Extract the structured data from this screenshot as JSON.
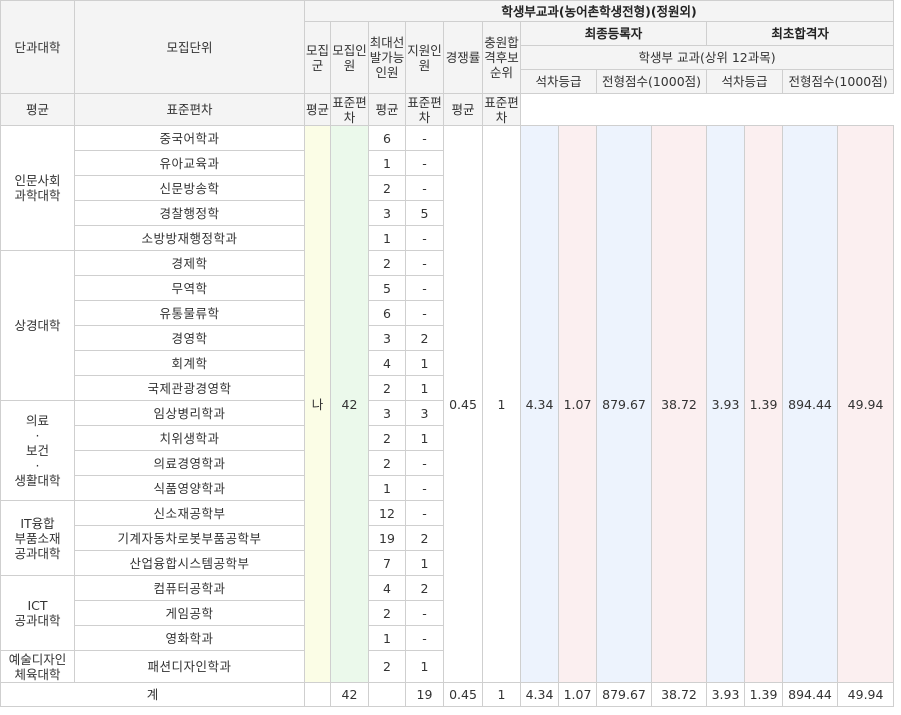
{
  "header": {
    "college": "단과대학",
    "unit": "모집단위",
    "group": "모집군",
    "recruit": "모집인원",
    "max_selectable": "최대선발가능인원",
    "applicants": "지원인원",
    "competition": "경쟁률",
    "waitlist": "충원합격후보순위",
    "main_title": "학생부교과(농어촌학생전형)(정원외)",
    "final_registered": "최종등록자",
    "first_passed": "최초합격자",
    "subject_basis": "학생부 교과(상위 12과목)",
    "grade": "석차등급",
    "score": "전형점수(1000점)",
    "avg": "평균",
    "std": "표준편차"
  },
  "merged": {
    "group": "나",
    "recruit": "42",
    "competition": "0.45",
    "waitlist": "1",
    "final": {
      "grade_avg": "4.34",
      "grade_std": "1.07",
      "score_avg": "879.67",
      "score_std": "38.72"
    },
    "first": {
      "grade_avg": "3.93",
      "grade_std": "1.39",
      "score_avg": "894.44",
      "score_std": "49.94"
    }
  },
  "colleges": [
    {
      "name": "인문사회과학대학",
      "rows": [
        {
          "unit": "중국어학과",
          "max": "6",
          "applicants": "-"
        },
        {
          "unit": "유아교육과",
          "max": "1",
          "applicants": "-"
        },
        {
          "unit": "신문방송학",
          "max": "2",
          "applicants": "-"
        },
        {
          "unit": "경찰행정학",
          "max": "3",
          "applicants": "5"
        },
        {
          "unit": "소방방재행정학과",
          "max": "1",
          "applicants": "-"
        }
      ]
    },
    {
      "name": "상경대학",
      "rows": [
        {
          "unit": "경제학",
          "max": "2",
          "applicants": "-"
        },
        {
          "unit": "무역학",
          "max": "5",
          "applicants": "-"
        },
        {
          "unit": "유통물류학",
          "max": "6",
          "applicants": "-"
        },
        {
          "unit": "경영학",
          "max": "3",
          "applicants": "2"
        },
        {
          "unit": "회계학",
          "max": "4",
          "applicants": "1"
        },
        {
          "unit": "국제관광경영학",
          "max": "2",
          "applicants": "1"
        }
      ]
    },
    {
      "name": "의료·보건·생활대학",
      "rows": [
        {
          "unit": "임상병리학과",
          "max": "3",
          "applicants": "3"
        },
        {
          "unit": "치위생학과",
          "max": "2",
          "applicants": "1"
        },
        {
          "unit": "의료경영학과",
          "max": "2",
          "applicants": "-"
        },
        {
          "unit": "식품영양학과",
          "max": "1",
          "applicants": "-"
        }
      ]
    },
    {
      "name": "IT융합부품소재공과대학",
      "rows": [
        {
          "unit": "신소재공학부",
          "max": "12",
          "applicants": "-"
        },
        {
          "unit": "기계자동차로봇부품공학부",
          "max": "19",
          "applicants": "2"
        },
        {
          "unit": "산업융합시스템공학부",
          "max": "7",
          "applicants": "1"
        }
      ]
    },
    {
      "name": "ICT공과대학",
      "rows": [
        {
          "unit": "컴퓨터공학과",
          "max": "4",
          "applicants": "2"
        },
        {
          "unit": "게임공학",
          "max": "2",
          "applicants": "-"
        },
        {
          "unit": "영화학과",
          "max": "1",
          "applicants": "-"
        }
      ]
    },
    {
      "name": "예술디자인체육대학",
      "rows": [
        {
          "unit": "패션디자인학과",
          "max": "2",
          "applicants": "1"
        }
      ]
    }
  ],
  "total": {
    "label": "계",
    "recruit": "42",
    "applicants": "19",
    "competition": "0.45",
    "waitlist": "1",
    "final": {
      "grade_avg": "4.34",
      "grade_std": "1.07",
      "score_avg": "879.67",
      "score_std": "38.72"
    },
    "first": {
      "grade_avg": "3.93",
      "grade_std": "1.39",
      "score_avg": "894.44",
      "score_std": "49.94"
    }
  }
}
